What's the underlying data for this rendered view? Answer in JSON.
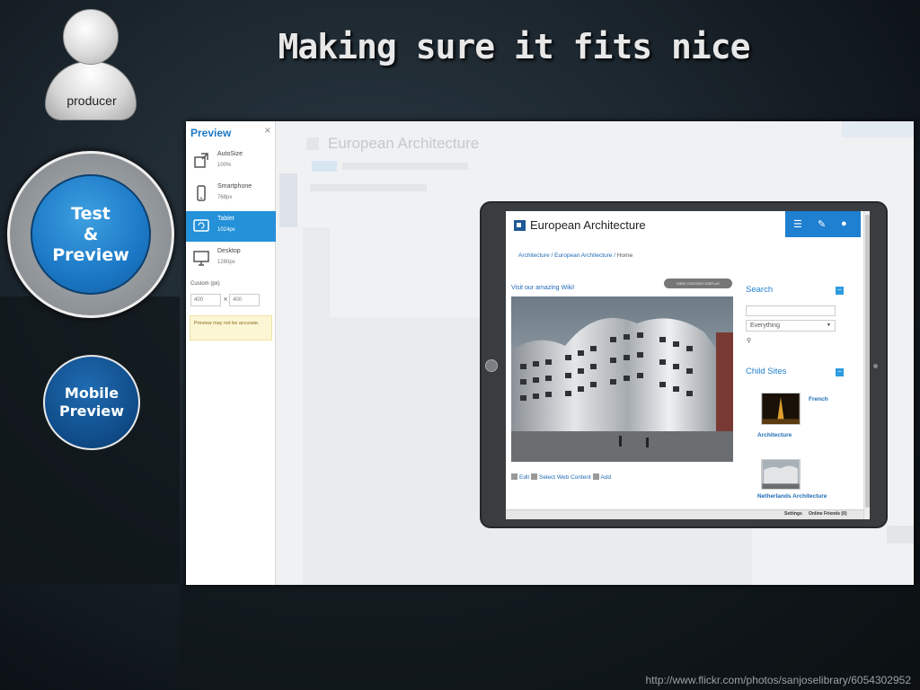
{
  "slide": {
    "title": "Making sure it fits nice",
    "producer_label": "producer",
    "steps": {
      "test_preview": [
        "Test",
        "&",
        "Preview"
      ],
      "mobile_preview": [
        "Mobile",
        "Preview"
      ]
    },
    "credit": "http://www.flickr.com/photos/sanjoselibrary/6054302952"
  },
  "preview_panel": {
    "title": "Preview",
    "close": "×",
    "devices": [
      {
        "name": "AutoSize",
        "size": "100%",
        "icon": "autosize-icon",
        "active": false
      },
      {
        "name": "Smartphone",
        "size": "768px",
        "icon": "smartphone-icon",
        "active": false
      },
      {
        "name": "Tablet",
        "size": "1024px",
        "icon": "tablet-icon",
        "active": true
      },
      {
        "name": "Desktop",
        "size": "1280px",
        "icon": "desktop-icon",
        "active": false
      }
    ],
    "custom_label": "Custom (px)",
    "custom_width": "400",
    "custom_height": "400",
    "custom_x": "×",
    "warning": "Preview may not be accurate."
  },
  "background_page": {
    "title": "European Architecture"
  },
  "tablet_page": {
    "site_title": "European Architecture",
    "breadcrumb": [
      "Architecture",
      "European Architecture",
      "Home"
    ],
    "breadcrumb_sep": " / ",
    "article_link": "Visit our amazing Wiki!",
    "pill_label": "VIEW CONTENT DISPLAY",
    "edit_actions": [
      "Edit",
      "Select Web Content",
      "Add"
    ],
    "search": {
      "title": "Search",
      "collapse": "−",
      "scope": "Everything",
      "caret": "▼",
      "icon": "search-icon"
    },
    "child_sites": {
      "title": "Child Sites",
      "collapse": "−",
      "items": [
        "French",
        "Architecture",
        "Netherlands Architecture"
      ]
    },
    "bottom_bar": [
      "Settings",
      "Online Friends (0)"
    ],
    "toolbar_icons": [
      "menu-icon",
      "pencil-icon",
      "user-icon"
    ]
  },
  "colors": {
    "accent_blue": "#1f7fd0",
    "step_blue": "#1b78c6",
    "mobile_blue": "#0f4a86"
  }
}
